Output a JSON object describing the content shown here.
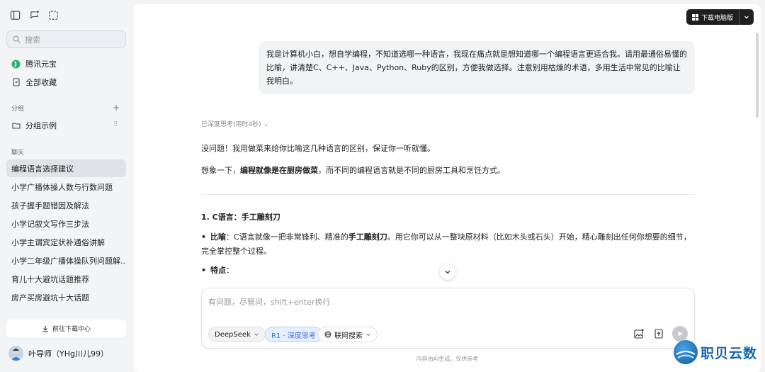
{
  "sidebar": {
    "search_placeholder": "搜索",
    "nav": [
      {
        "label": "腾讯元宝",
        "icon": "yuanbao-logo-icon"
      },
      {
        "label": "全部收藏",
        "icon": "bookmark-icon"
      }
    ],
    "group_label": "分组",
    "group_item": "分组示例",
    "chat_label": "聊天",
    "chats": [
      "编程语言选择建议",
      "小学广播体操人数与行数问题",
      "孩子握手题错因及解法",
      "小学记叙文写作三步法",
      "小学主谓宾定状补通俗讲解",
      "小学二年级广播体操队列问题解...",
      "育儿十大避坑话题推荐",
      "房产买房避坑十大话题"
    ],
    "download_center": "前往下载中心",
    "user_name": "叶导师（YHg川儿99）"
  },
  "header": {
    "download_pc": "下载电脑版"
  },
  "conversation": {
    "user_message": "我是计算机小白，想自学编程，不知道选哪一种语言，我现在痛点就是想知道哪一个编程语言更适合我。请用最通俗易懂的比喻，讲清楚C、C++、Java、Python、Ruby的区别，方便我做选择。注意别用枯燥的术语，多用生活中常见的比喻让我明白。",
    "think_status": "已深度思考(用时4秒)",
    "intro": "没问题！我用做菜来给你比喻这几种语言的区别，保证你一听就懂。",
    "analogy_prefix": "想象一下，",
    "analogy_bold": "编程就像是在厨房做菜",
    "analogy_suffix": "，而不同的编程语言就是不同的厨房工具和烹饪方式。",
    "section_title": "1. C语言：手工雕刻刀",
    "bullet1_label": "比喻",
    "bullet1_text_a": "：C语言就像一把非常锋利、精准的",
    "bullet1_bold": "手工雕刻刀",
    "bullet1_text_b": "。用它你可以从一整块原材料（比如木头或石头）开始，精心雕刻出任何你想要的细节，完全掌控整个过程。",
    "bullet2_label": "特点",
    "bullet2_text": "："
  },
  "input": {
    "placeholder": "有问题，尽管问，shift+enter换行",
    "model_chip": "DeepSeek",
    "r1_chip": "R1 · 深度思考",
    "web_chip": "联网搜索"
  },
  "footer_note": "内容由AI生成，仅供参考",
  "watermark_text": "职贝云数"
}
